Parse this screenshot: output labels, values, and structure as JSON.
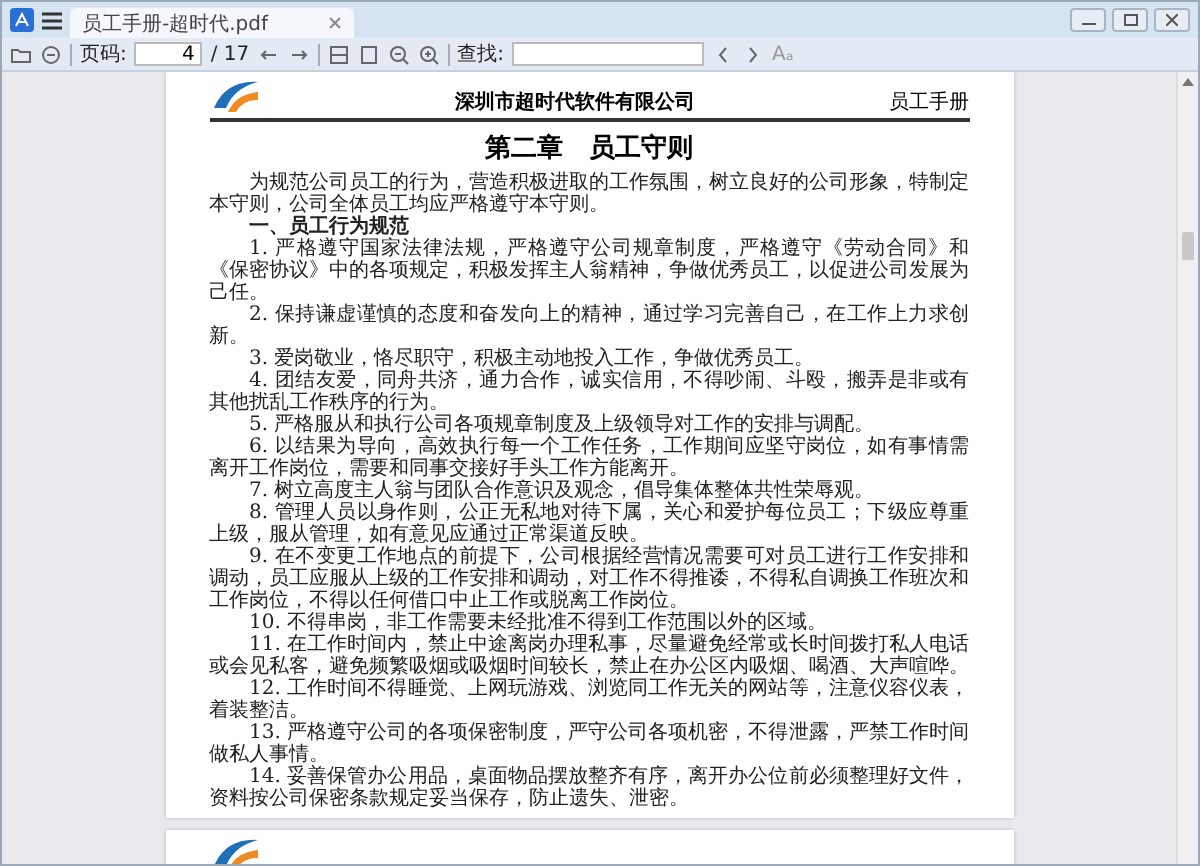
{
  "tab": {
    "title": "员工手册-超时代.pdf",
    "selected": true
  },
  "toolbar": {
    "page_label": "页码:",
    "page_value": "4",
    "page_total": "/ 17",
    "find_label": "查找:",
    "case_button": "Aₐ"
  },
  "page": {
    "company": "深圳市超时代软件有限公司",
    "header_right": "员工手册",
    "title": "第二章　员工守则",
    "paragraphs": [
      {
        "kind": "body",
        "text": "为规范公司员工的行为，营造积极进取的工作氛围，树立良好的公司形象，特制定本守则，公司全体员工均应严格遵守本守则。"
      },
      {
        "kind": "heading",
        "text": "一、员工行为规范"
      },
      {
        "kind": "body",
        "text": "1. 严格遵守国家法律法规，严格遵守公司规章制度，严格遵守《劳动合同》和《保密协议》中的各项规定，积极发挥主人翁精神，争做优秀员工，以促进公司发展为己任。"
      },
      {
        "kind": "body",
        "text": "2. 保持谦虚谨慎的态度和奋发向上的精神，通过学习完善自己，在工作上力求创新。"
      },
      {
        "kind": "body",
        "text": "3. 爱岗敬业，恪尽职守，积极主动地投入工作，争做优秀员工。"
      },
      {
        "kind": "body",
        "text": "4. 团结友爱，同舟共济，通力合作，诚实信用，不得吵闹、斗殴，搬弄是非或有其他扰乱工作秩序的行为。"
      },
      {
        "kind": "body",
        "text": "5. 严格服从和执行公司各项规章制度及上级领导对工作的安排与调配。"
      },
      {
        "kind": "body",
        "text": "6. 以结果为导向，高效执行每一个工作任务，工作期间应坚守岗位，如有事情需离开工作岗位，需要和同事交接好手头工作方能离开。"
      },
      {
        "kind": "body",
        "text": "7. 树立高度主人翁与团队合作意识及观念，倡导集体整体共性荣辱观。"
      },
      {
        "kind": "body",
        "text": "8. 管理人员以身作则，公正无私地对待下属，关心和爱护每位员工；下级应尊重上级，服从管理，如有意见应通过正常渠道反映。"
      },
      {
        "kind": "body",
        "text": "9. 在不变更工作地点的前提下，公司根据经营情况需要可对员工进行工作安排和调动，员工应服从上级的工作安排和调动，对工作不得推诿，不得私自调换工作班次和工作岗位，不得以任何借口中止工作或脱离工作岗位。"
      },
      {
        "kind": "body",
        "text": "10. 不得串岗，非工作需要未经批准不得到工作范围以外的区域。"
      },
      {
        "kind": "body",
        "text": "11. 在工作时间内，禁止中途离岗办理私事，尽量避免经常或长时间拨打私人电话或会见私客，避免频繁吸烟或吸烟时间较长，禁止在办公区内吸烟、喝酒、大声喧哗。"
      },
      {
        "kind": "body",
        "text": "12. 工作时间不得睡觉、上网玩游戏、浏览同工作无关的网站等，注意仪容仪表，着装整洁。"
      },
      {
        "kind": "body",
        "text": "13. 严格遵守公司的各项保密制度，严守公司各项机密，不得泄露，严禁工作时间做私人事情。"
      },
      {
        "kind": "body",
        "text": "14. 妥善保管办公用品，桌面物品摆放整齐有序，离开办公位前必须整理好文件，资料按公司保密条款规定妥当保存，防止遗失、泄密。"
      }
    ]
  }
}
